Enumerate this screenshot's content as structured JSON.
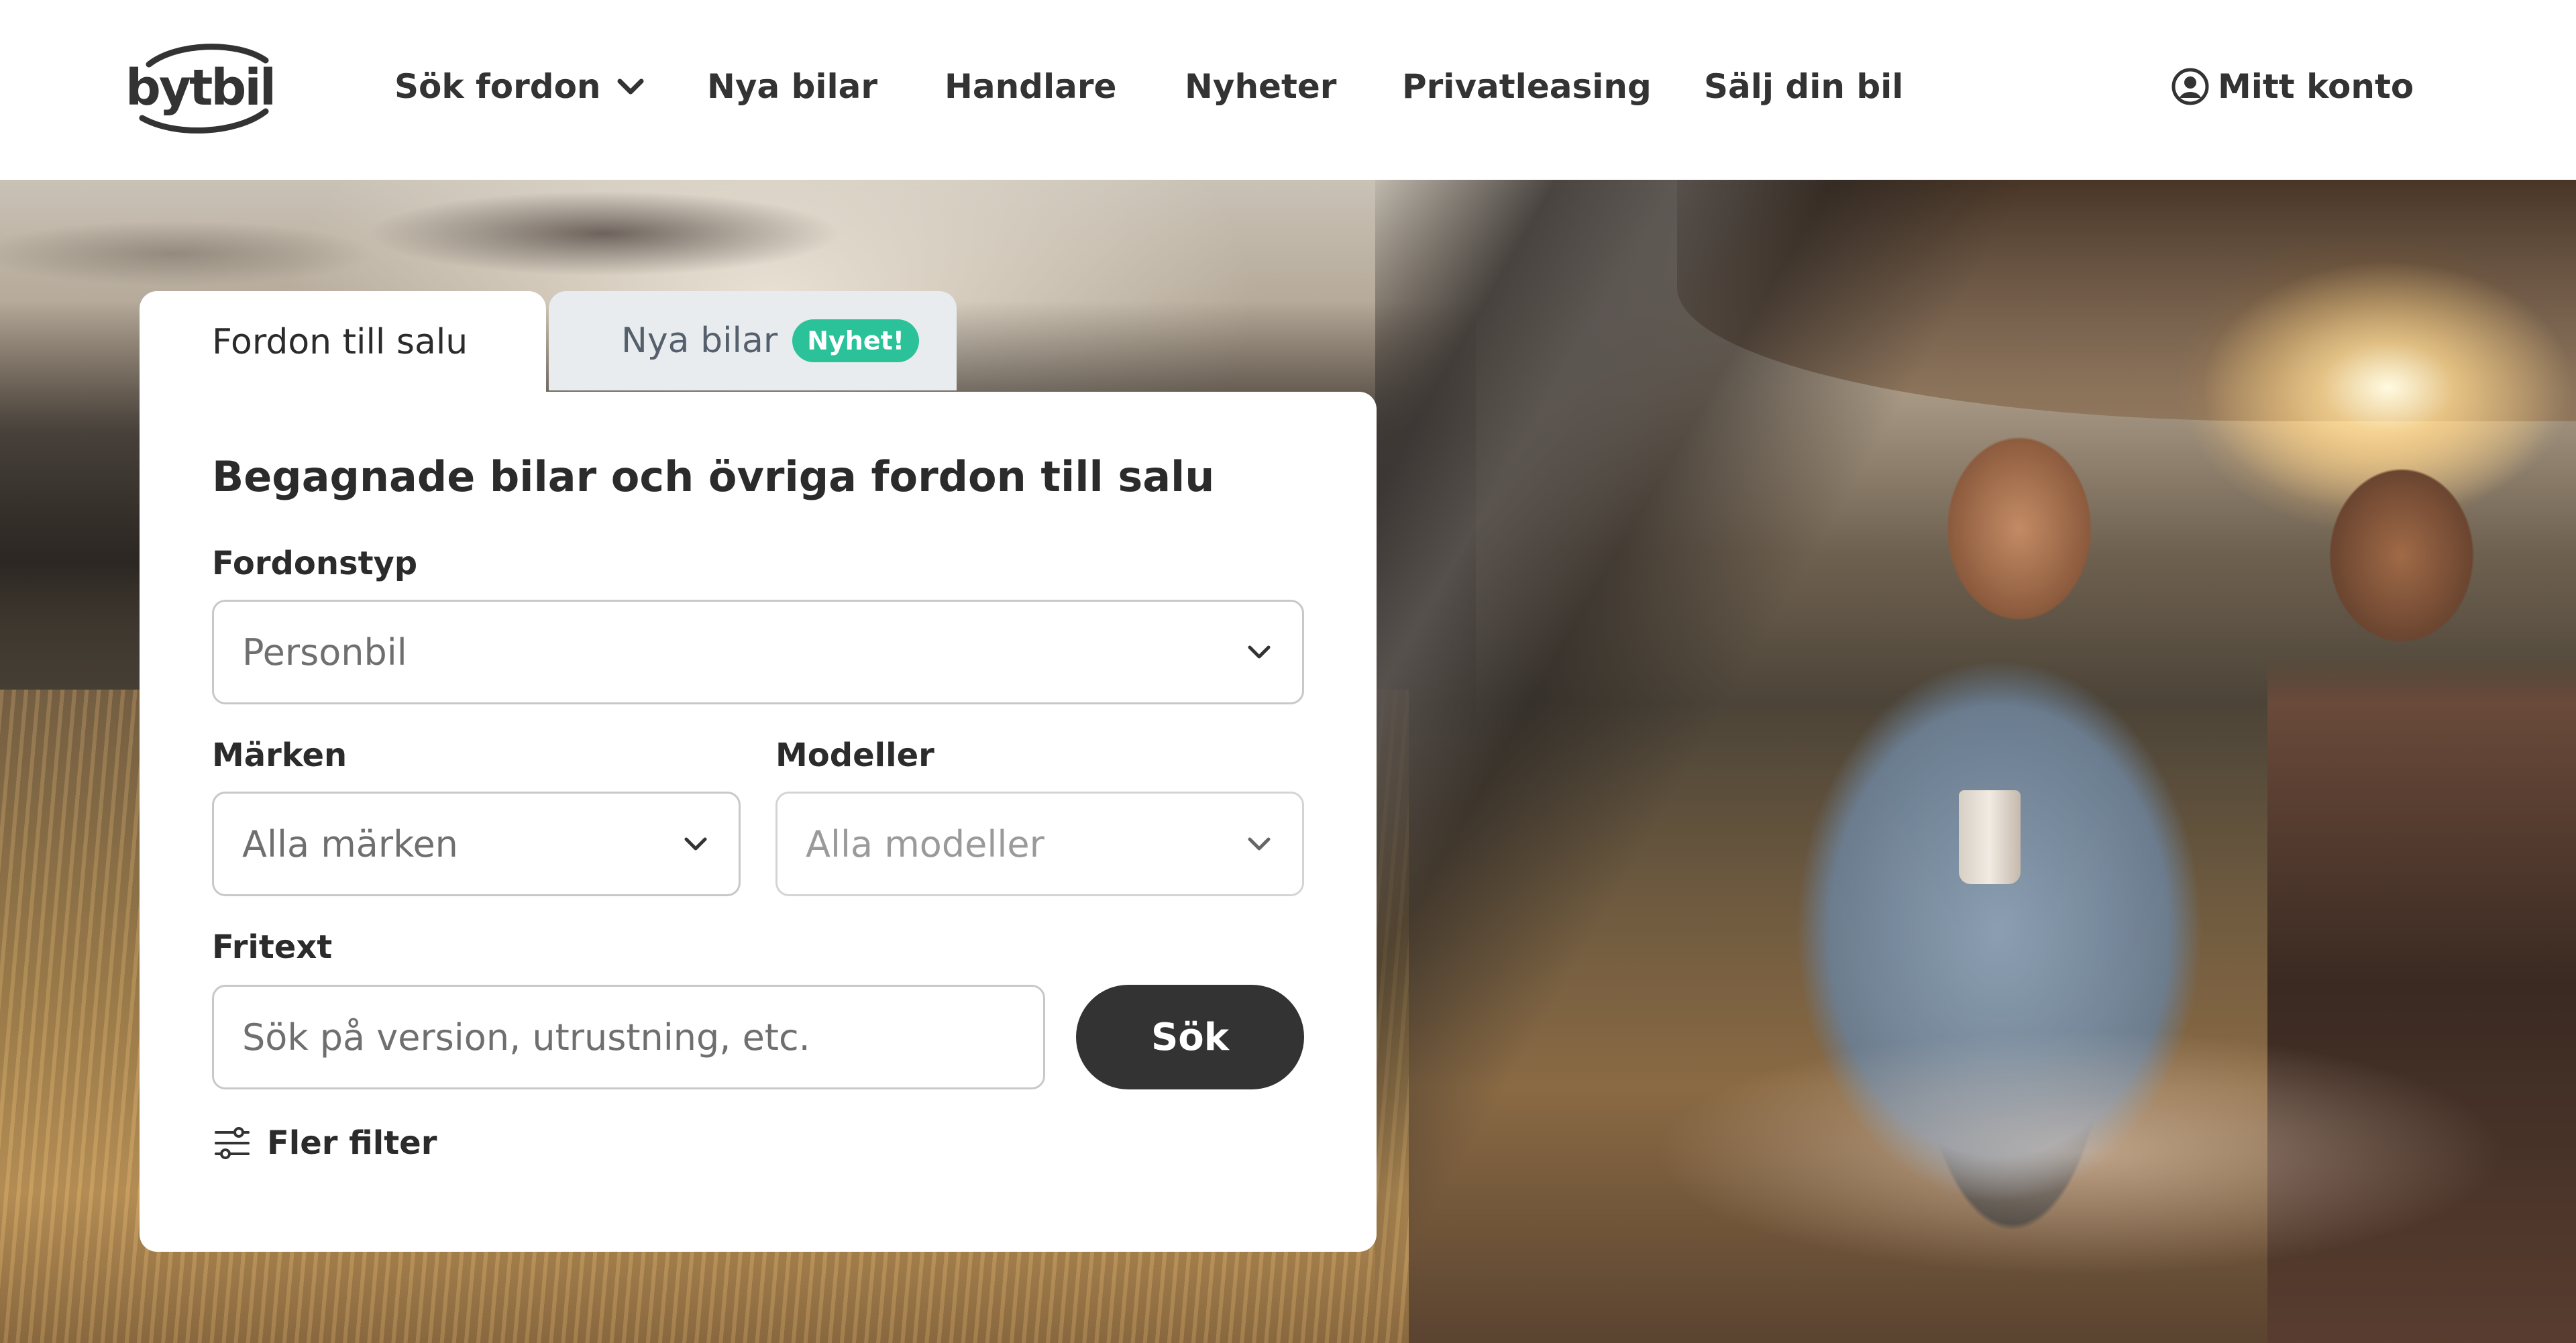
{
  "brand": {
    "logo_text": "bytbil",
    "logo_color": "#333333"
  },
  "nav": {
    "items": [
      {
        "label": "Sök fordon",
        "has_dropdown": true
      },
      {
        "label": "Nya bilar"
      },
      {
        "label": "Handlare"
      },
      {
        "label": "Nyheter"
      },
      {
        "label": "Privatleasing"
      },
      {
        "label": "Sälj din bil"
      }
    ],
    "account_label": "Mitt konto"
  },
  "search": {
    "tabs": [
      {
        "label": "Fordon till salu",
        "active": true
      },
      {
        "label": "Nya bilar",
        "badge": "Nyhet!",
        "active": false
      }
    ],
    "title": "Begagnade bilar och övriga fordon till salu",
    "vehicle_type": {
      "label": "Fordonstyp",
      "value": "Personbil"
    },
    "brands": {
      "label": "Märken",
      "value": "Alla märken"
    },
    "models": {
      "label": "Modeller",
      "value": "Alla modeller",
      "disabled": true
    },
    "freetext": {
      "label": "Fritext",
      "placeholder": "Sök på version, utrustning, etc."
    },
    "submit_label": "Sök",
    "more_filters_label": "Fler filter"
  },
  "colors": {
    "accent_badge": "#2bc29a",
    "button_dark": "#333333",
    "text": "#2b2b2b",
    "inactive_tab": "#e9ecef"
  }
}
